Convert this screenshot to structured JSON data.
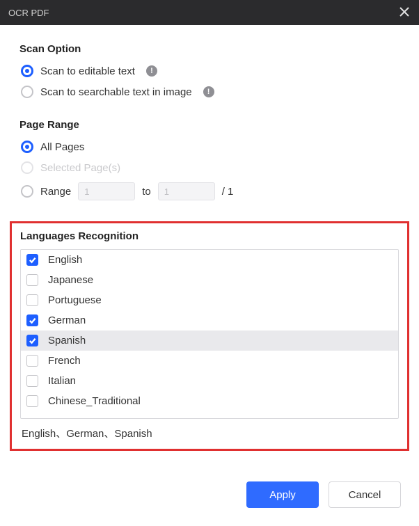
{
  "titlebar": {
    "title": "OCR PDF"
  },
  "scan": {
    "section_title": "Scan Option",
    "options": [
      {
        "label": "Scan to editable text",
        "selected": true,
        "has_info": true
      },
      {
        "label": "Scan to searchable text in image",
        "selected": false,
        "has_info": true
      }
    ]
  },
  "page_range": {
    "section_title": "Page Range",
    "all_pages_label": "All Pages",
    "selected_pages_label": "Selected Page(s)",
    "range_label": "Range",
    "to_label": "to",
    "from_value": "1",
    "to_value": "1",
    "total_display": "/ 1"
  },
  "languages": {
    "section_title": "Languages Recognition",
    "items": [
      {
        "label": "English",
        "checked": true
      },
      {
        "label": "Japanese",
        "checked": false
      },
      {
        "label": "Portuguese",
        "checked": false
      },
      {
        "label": "German",
        "checked": true
      },
      {
        "label": "Spanish",
        "checked": true,
        "highlight": true
      },
      {
        "label": "French",
        "checked": false
      },
      {
        "label": "Italian",
        "checked": false
      },
      {
        "label": "Chinese_Traditional",
        "checked": false
      }
    ],
    "summary": "English、German、Spanish"
  },
  "footer": {
    "apply_label": "Apply",
    "cancel_label": "Cancel"
  }
}
